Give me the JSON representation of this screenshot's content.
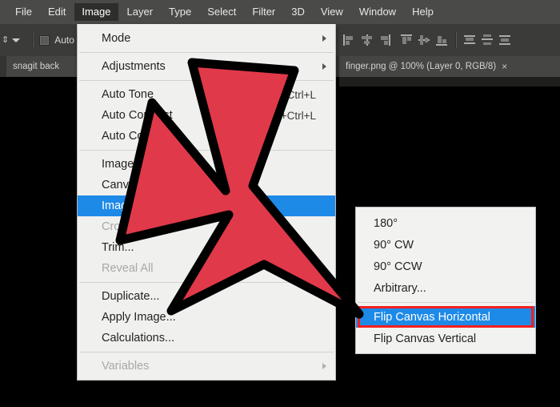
{
  "app": {
    "accent_blue": "#1E8AE8",
    "menu_bg": "#F0F0EE",
    "menubar_bg": "#4A4A48",
    "arrow_red": "#E0394A",
    "highlight_border_red": "#F41F1F"
  },
  "menubar": {
    "items": [
      {
        "label": "File",
        "active": false
      },
      {
        "label": "Edit",
        "active": false
      },
      {
        "label": "Image",
        "active": true
      },
      {
        "label": "Layer",
        "active": false
      },
      {
        "label": "Type",
        "active": false
      },
      {
        "label": "Select",
        "active": false
      },
      {
        "label": "Filter",
        "active": false
      },
      {
        "label": "3D",
        "active": false
      },
      {
        "label": "View",
        "active": false
      },
      {
        "label": "Window",
        "active": false
      },
      {
        "label": "Help",
        "active": false
      }
    ]
  },
  "options_bar": {
    "auto_checkbox_label": "Auto",
    "auto_checked": false,
    "align_icons": [
      "align-left-edges-icon",
      "align-horizontal-centers-icon",
      "align-right-edges-icon",
      "align-top-edges-icon",
      "align-vertical-centers-icon",
      "align-bottom-edges-icon",
      "distribute-top-edges-icon",
      "distribute-vertical-centers-icon",
      "distribute-bottom-edges-icon"
    ]
  },
  "tabs": [
    {
      "label": "snagit back",
      "closable": false
    },
    {
      "label": "finger.png @ 100% (Layer 0, RGB/8)",
      "close_glyph": "×",
      "closable": true
    }
  ],
  "image_menu": {
    "groups": [
      {
        "items": [
          {
            "label": "Mode",
            "submenu": true,
            "disabled": false,
            "selected": false,
            "shortcut": ""
          },
          {
            "label": "Adjustments",
            "submenu": true,
            "disabled": false,
            "selected": false,
            "shortcut": ""
          }
        ]
      },
      {
        "items": [
          {
            "label": "Auto Tone",
            "submenu": false,
            "disabled": false,
            "selected": false,
            "shortcut": "Shift+Ctrl+L"
          },
          {
            "label": "Auto Contrast",
            "submenu": false,
            "disabled": false,
            "selected": false,
            "shortcut": "Alt+Shift+Ctrl+L"
          },
          {
            "label": "Auto Color",
            "submenu": false,
            "disabled": false,
            "selected": false,
            "shortcut": ""
          }
        ]
      },
      {
        "items": [
          {
            "label": "Image Size...",
            "submenu": false,
            "disabled": false,
            "selected": false,
            "shortcut": ""
          },
          {
            "label": "Canvas Size...",
            "submenu": false,
            "disabled": false,
            "selected": false,
            "shortcut": ""
          },
          {
            "label": "Image Rotation",
            "submenu": true,
            "disabled": false,
            "selected": true,
            "shortcut": ""
          },
          {
            "label": "Crop",
            "submenu": false,
            "disabled": true,
            "selected": false,
            "shortcut": ""
          },
          {
            "label": "Trim...",
            "submenu": false,
            "disabled": false,
            "selected": false,
            "shortcut": ""
          },
          {
            "label": "Reveal All",
            "submenu": false,
            "disabled": true,
            "selected": false,
            "shortcut": ""
          }
        ]
      },
      {
        "items": [
          {
            "label": "Duplicate...",
            "submenu": false,
            "disabled": false,
            "selected": false,
            "shortcut": ""
          },
          {
            "label": "Apply Image...",
            "submenu": false,
            "disabled": false,
            "selected": false,
            "shortcut": ""
          },
          {
            "label": "Calculations...",
            "submenu": false,
            "disabled": false,
            "selected": false,
            "shortcut": ""
          }
        ]
      },
      {
        "items": [
          {
            "label": "Variables",
            "submenu": true,
            "disabled": true,
            "selected": false,
            "shortcut": ""
          }
        ]
      }
    ]
  },
  "rotation_submenu": {
    "groups": [
      {
        "items": [
          {
            "label": "180°",
            "selected": false
          },
          {
            "label": "90° CW",
            "selected": false
          },
          {
            "label": "90° CCW",
            "selected": false
          },
          {
            "label": "Arbitrary...",
            "selected": false
          }
        ]
      },
      {
        "items": [
          {
            "label": "Flip Canvas Horizontal",
            "selected": true
          },
          {
            "label": "Flip Canvas Vertical",
            "selected": false
          }
        ]
      }
    ]
  },
  "annotation": {
    "arrow_name": "red-pointer-arrow",
    "points_at": "Flip Canvas Horizontal"
  }
}
